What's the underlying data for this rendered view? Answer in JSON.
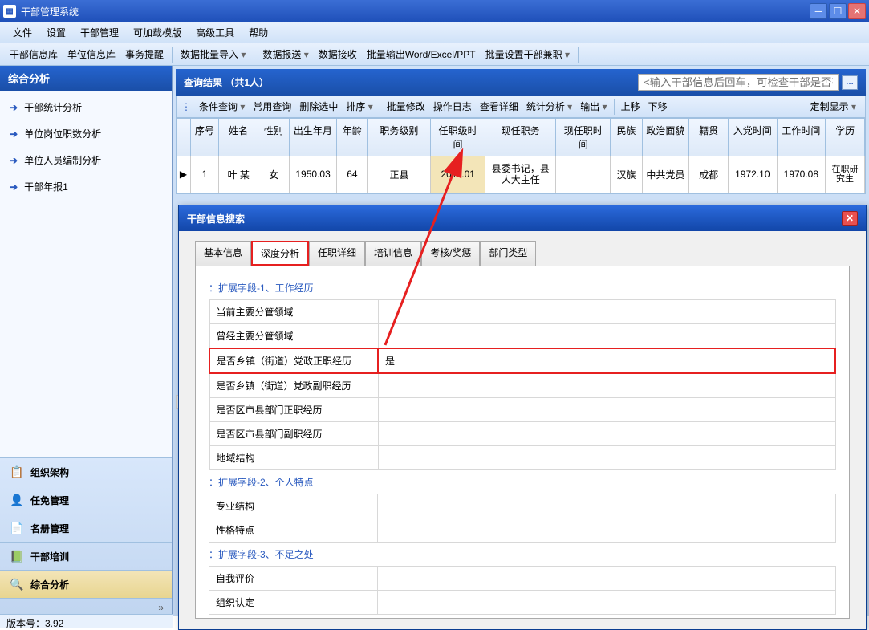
{
  "window": {
    "title": "干部管理系统"
  },
  "menubar": [
    "文件",
    "设置",
    "干部管理",
    "可加载模版",
    "高级工具",
    "帮助"
  ],
  "toolbar1": {
    "items": [
      "干部信息库",
      "单位信息库",
      "事务提醒"
    ],
    "items2": [
      "数据批量导入",
      "数据报送",
      "数据接收",
      "批量输出Word/Excel/PPT",
      "批量设置干部兼职"
    ]
  },
  "sidebar": {
    "header": "综合分析",
    "items": [
      "干部统计分析",
      "单位岗位职数分析",
      "单位人员编制分析",
      "干部年报1"
    ],
    "bottom": [
      {
        "icon": "📋",
        "label": "组织架构"
      },
      {
        "icon": "👤",
        "label": "任免管理"
      },
      {
        "icon": "📄",
        "label": "名册管理"
      },
      {
        "icon": "📗",
        "label": "干部培训"
      },
      {
        "icon": "🔍",
        "label": "综合分析"
      }
    ],
    "more": "»"
  },
  "result": {
    "title": "查询结果 （共1人）",
    "search_hint": "<输入干部信息后回车，可检查干部是否存在>",
    "search_btn": "…"
  },
  "query_toolbar": {
    "left": [
      "条件查询",
      "常用查询",
      "删除选中",
      "排序"
    ],
    "mid": [
      "批量修改",
      "操作日志",
      "查看详细",
      "统计分析",
      "输出"
    ],
    "mid2": [
      "上移",
      "下移"
    ],
    "right": "定制显示"
  },
  "grid": {
    "cols": [
      "",
      "序号",
      "姓名",
      "性别",
      "出生年月",
      "年龄",
      "职务级别",
      "任职级时间",
      "现任职务",
      "现任职时间",
      "民族",
      "政治面貌",
      "籍贯",
      "入党时间",
      "工作时间",
      "学历"
    ],
    "row": [
      "▶",
      "1",
      "叶 某",
      "女",
      "1950.03",
      "64",
      "正县",
      "2011.01",
      "县委书记，县人大主任",
      "",
      "汉族",
      "中共党员",
      "成都",
      "1972.10",
      "1970.08",
      "在职研究生"
    ]
  },
  "modal": {
    "title": "干部信息搜索",
    "tabs": [
      "基本信息",
      "深度分析",
      "任职详细",
      "培训信息",
      "考核/奖惩",
      "部门类型"
    ],
    "section1": "：扩展字段-1、工作经历",
    "fields1": [
      {
        "label": "当前主要分管领域",
        "value": ""
      },
      {
        "label": "曾经主要分管领域",
        "value": ""
      },
      {
        "label": "是否乡镇（街道）党政正职经历",
        "value": "是"
      },
      {
        "label": "是否乡镇（街道）党政副职经历",
        "value": ""
      },
      {
        "label": "是否区市县部门正职经历",
        "value": ""
      },
      {
        "label": "是否区市县部门副职经历",
        "value": ""
      },
      {
        "label": "地域结构",
        "value": ""
      }
    ],
    "section2": "：扩展字段-2、个人特点",
    "fields2": [
      {
        "label": "专业结构",
        "value": ""
      },
      {
        "label": "性格特点",
        "value": ""
      }
    ],
    "section3": "：扩展字段-3、不足之处",
    "fields3": [
      {
        "label": "自我评价",
        "value": ""
      },
      {
        "label": "组织认定",
        "value": ""
      }
    ]
  },
  "statusbar": "版本号：3.92"
}
